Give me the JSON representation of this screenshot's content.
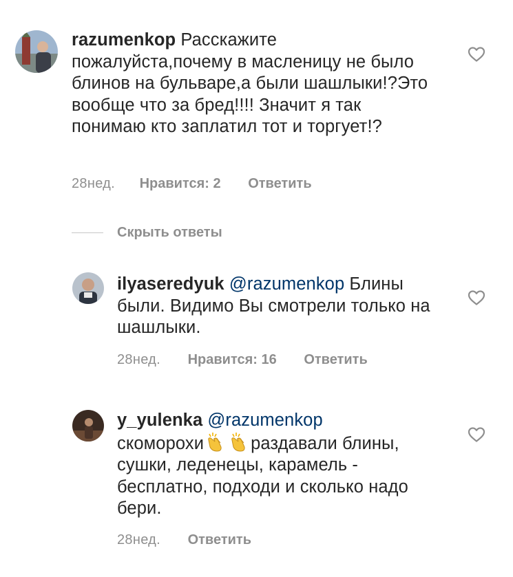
{
  "comments": [
    {
      "username": "razumenkop",
      "text": "Расскажите пожалуйста,почему в масленицу не было блинов на бульваре,а были шашлыки!?Это вообще что за бред!!!! Значит я так понимаю кто заплатил тот и торгует!?",
      "time": "28нед.",
      "likes": "Нравится: 2",
      "reply": "Ответить"
    }
  ],
  "hide_replies_label": "Скрыть ответы",
  "replies": [
    {
      "username": "ilyaseredyuk",
      "mention": "@razumenkop",
      "text": "Блины были. Видимо Вы смотрели только на шашлыки.",
      "time": "28нед.",
      "likes": "Нравится: 16",
      "reply": "Ответить"
    },
    {
      "username": "y_yulenka",
      "mention": "@razumenkop",
      "text_before_emoji": "скоморохи",
      "emoji": [
        "clapping-hands",
        "clapping-hands"
      ],
      "text_after_emoji": "раздавали блины, сушки, леденецы, карамель - бесплатно, подходи  и сколько надо бери.",
      "time": "28нед.",
      "reply": "Ответить"
    }
  ],
  "icons": {
    "like": "heart-outline-icon"
  },
  "colors": {
    "text": "#262626",
    "secondary": "#8e8e8e",
    "mention": "#003569",
    "divider": "#c7c7c7"
  }
}
